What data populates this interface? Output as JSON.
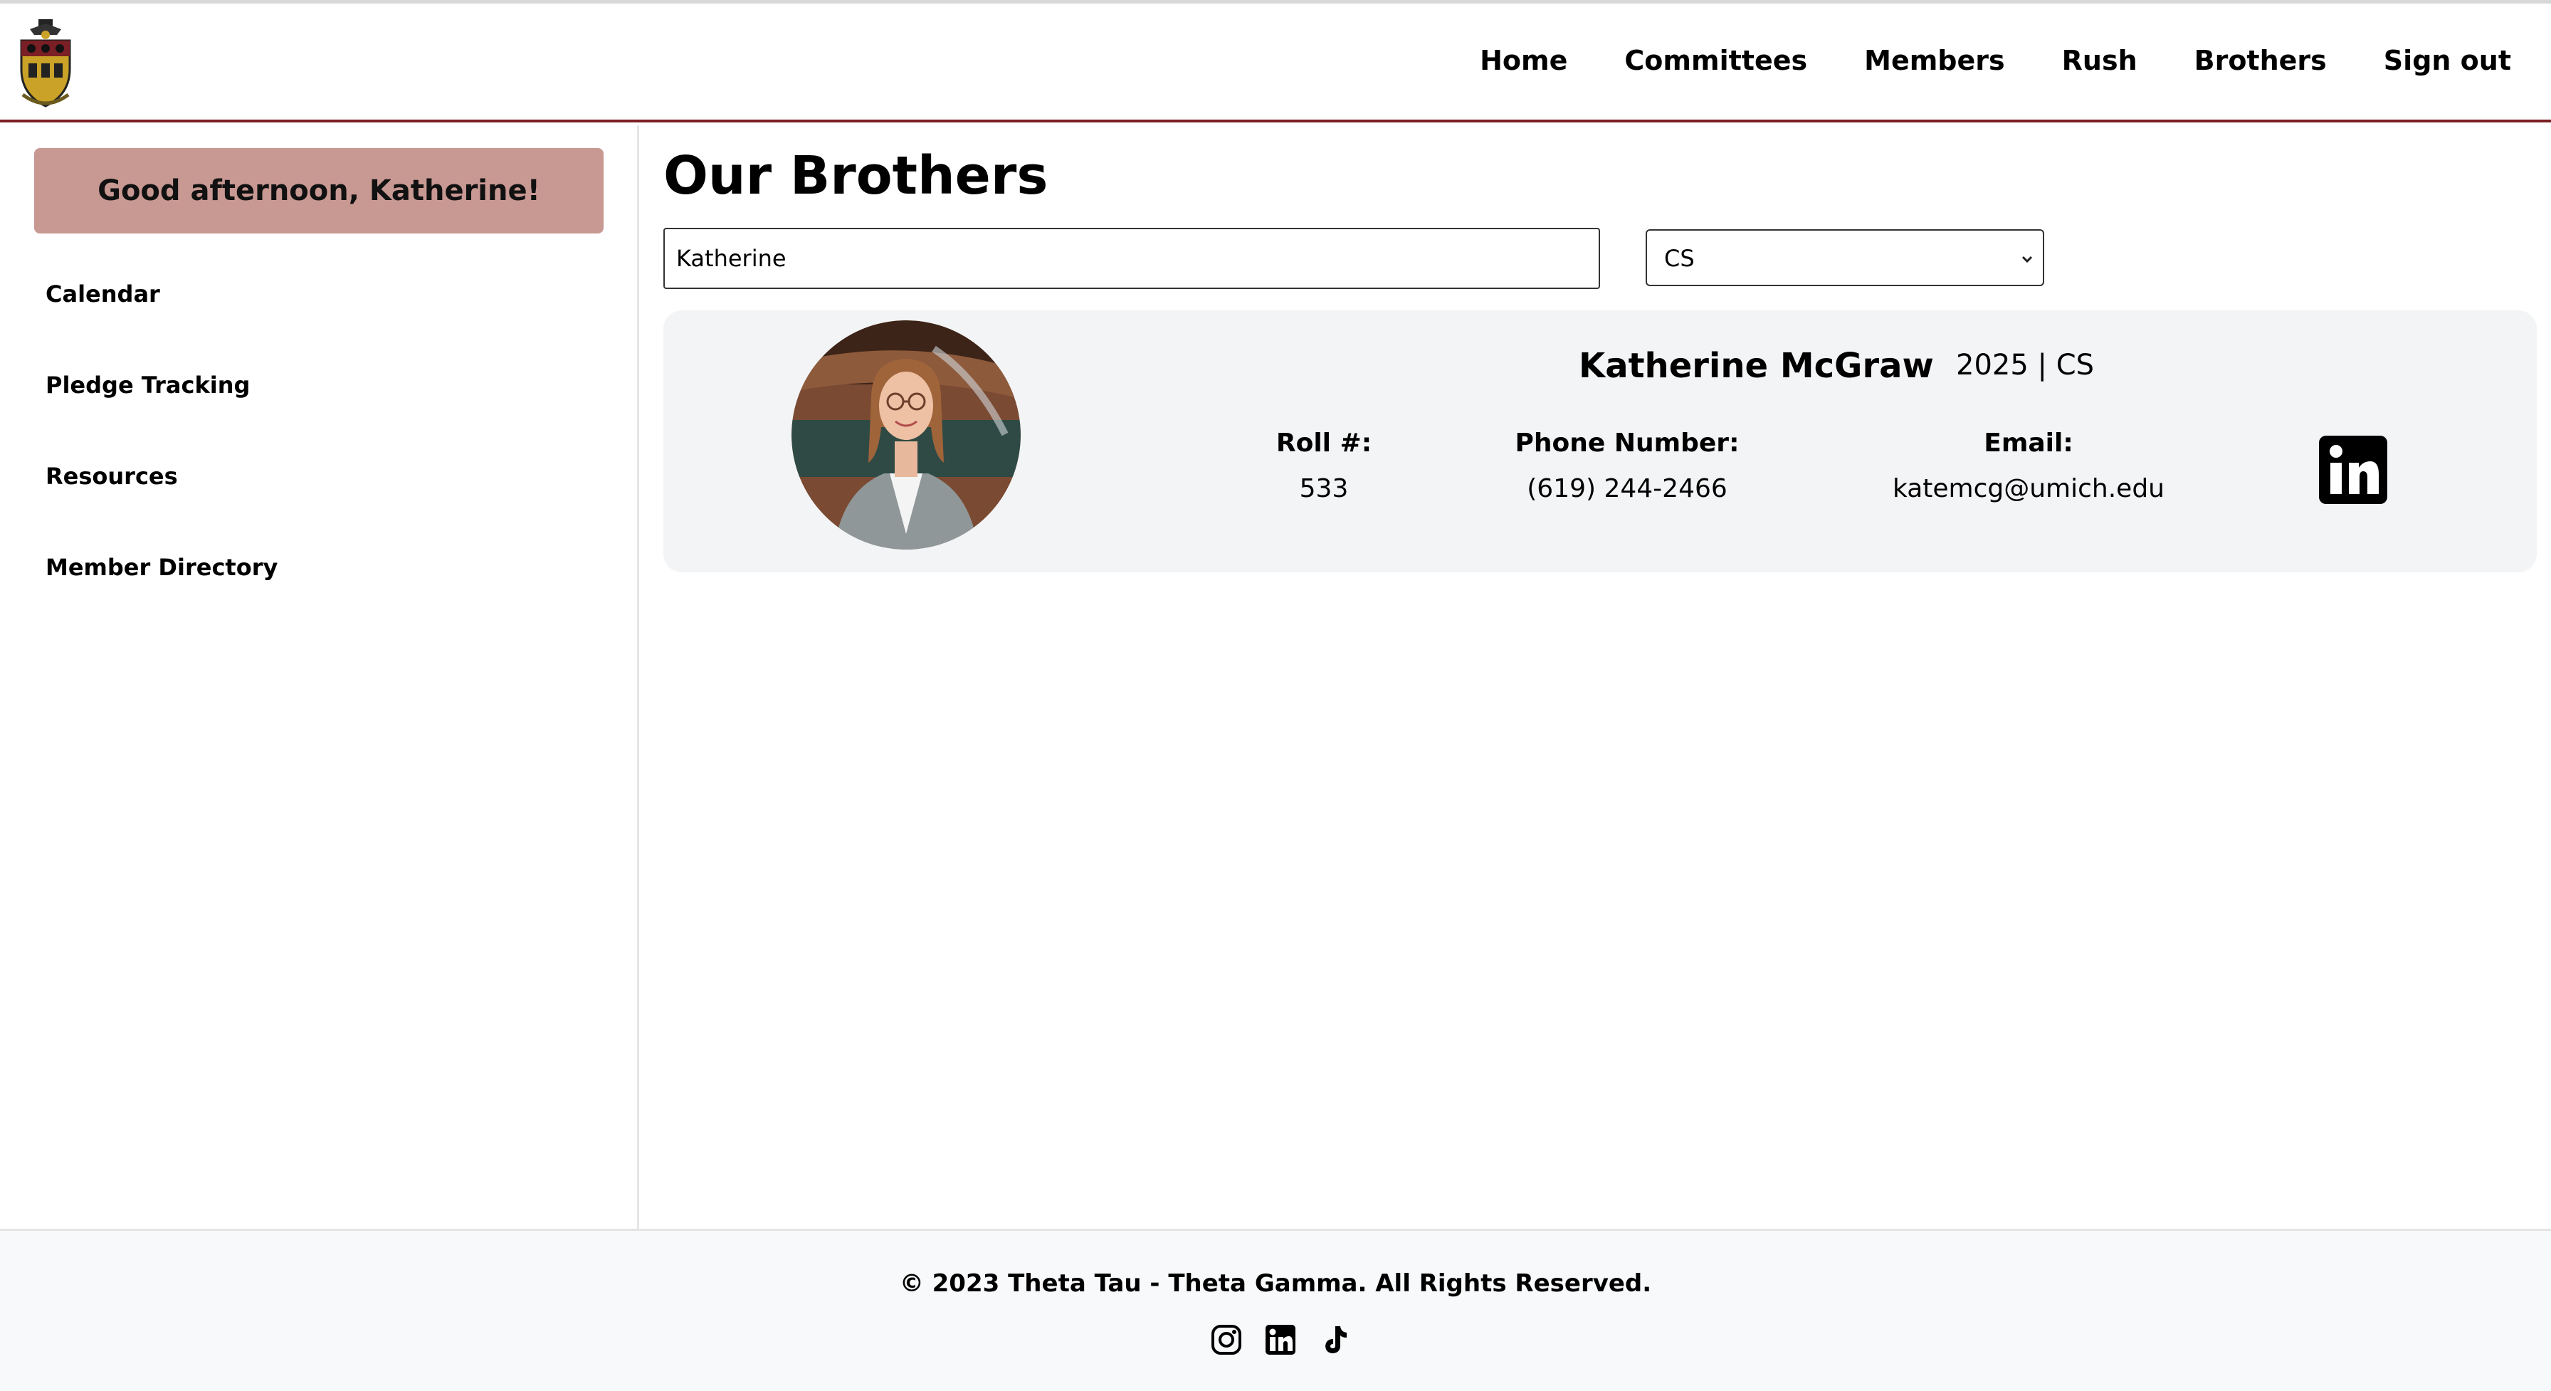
{
  "header": {
    "logo_icon": "fraternity-crest-icon",
    "nav": [
      "Home",
      "Committees",
      "Members",
      "Rush",
      "Brothers",
      "Sign out"
    ]
  },
  "sidebar": {
    "greeting": "Good afternoon, Katherine!",
    "links": [
      "Calendar",
      "Pledge Tracking",
      "Resources",
      "Member Directory"
    ]
  },
  "main": {
    "title": "Our Brothers",
    "search": {
      "value": "Katherine"
    },
    "filter": {
      "selected": "CS"
    },
    "member": {
      "name": "Katherine McGraw",
      "year_major": "2025 | CS",
      "roll_label": "Roll #:",
      "roll_value": "533",
      "phone_label": "Phone Number:",
      "phone_value": "(619) 244-2466",
      "email_label": "Email:",
      "email_value": "katemcg@umich.edu",
      "profile_icon": "linkedin-icon"
    }
  },
  "footer": {
    "copyright": "© 2023 Theta Tau - Theta Gamma. All Rights Reserved.",
    "social_icons": [
      "instagram-icon",
      "linkedin-icon",
      "tiktok-icon"
    ]
  },
  "colors": {
    "accent": "#7a1f25",
    "greeting_bg": "#c89893",
    "card_bg": "#f3f4f5",
    "footer_bg": "#f8f9fa"
  }
}
